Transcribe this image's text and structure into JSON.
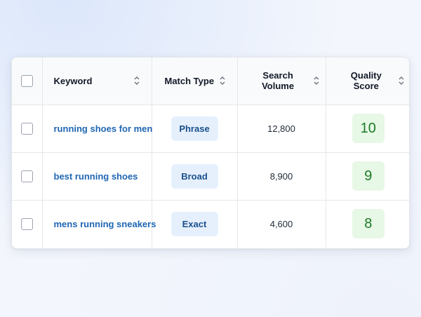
{
  "table": {
    "headers": {
      "keyword": "Keyword",
      "match_type": "Match Type",
      "search_volume": "Search Volume",
      "quality_score": "Quality Score"
    },
    "rows": [
      {
        "keyword": "running shoes for men",
        "match_type": "Phrase",
        "search_volume": "12,800",
        "quality_score": "10"
      },
      {
        "keyword": "best running shoes",
        "match_type": "Broad",
        "search_volume": "8,900",
        "quality_score": "9"
      },
      {
        "keyword": "mens running sneakers",
        "match_type": "Exact",
        "search_volume": "4,600",
        "quality_score": "8"
      }
    ]
  },
  "colors": {
    "link": "#1f66b3",
    "pill_bg": "#e6f0fd",
    "score_bg": "#e7f8e6",
    "score_text": "#1d7a26"
  },
  "icons": {
    "sort": "sort-up-down-icon",
    "checkbox": "checkbox-icon"
  }
}
